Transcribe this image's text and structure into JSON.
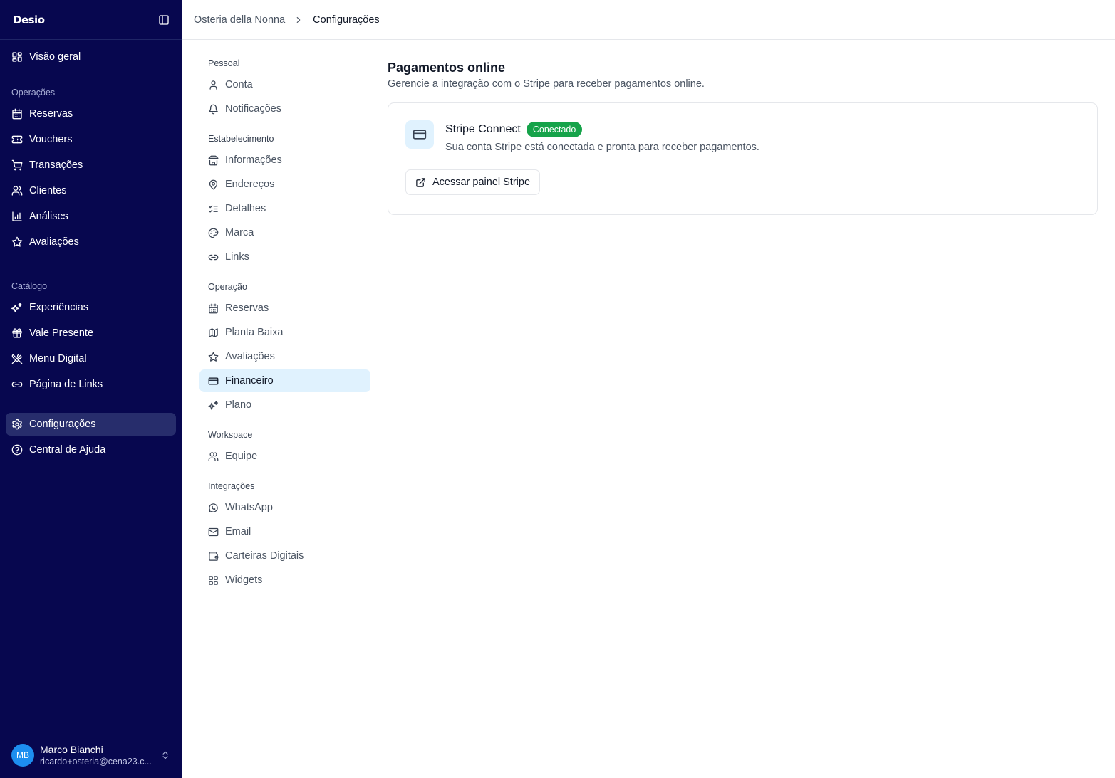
{
  "sidebar": {
    "logo": "Desio",
    "overview": "Visão geral",
    "groups": [
      {
        "label": "Operações",
        "items": [
          "Reservas",
          "Vouchers",
          "Transações",
          "Clientes",
          "Análises",
          "Avaliações"
        ]
      },
      {
        "label": "Catálogo",
        "items": [
          "Experiências",
          "Vale Presente",
          "Menu Digital",
          "Página de Links"
        ]
      }
    ],
    "bottom_items": [
      "Configurações",
      "Central de Ajuda"
    ],
    "user": {
      "initials": "MB",
      "name": "Marco Bianchi",
      "email": "ricardo+osteria@cena23.c..."
    }
  },
  "breadcrumb": {
    "parent": "Osteria della Nonna",
    "current": "Configurações"
  },
  "settings_nav": {
    "groups": [
      {
        "label": "Pessoal",
        "items": [
          "Conta",
          "Notificações"
        ]
      },
      {
        "label": "Estabelecimento",
        "items": [
          "Informações",
          "Endereços",
          "Detalhes",
          "Marca",
          "Links"
        ]
      },
      {
        "label": "Operação",
        "items": [
          "Reservas",
          "Planta Baixa",
          "Avaliações",
          "Financeiro",
          "Plano"
        ]
      },
      {
        "label": "Workspace",
        "items": [
          "Equipe"
        ]
      },
      {
        "label": "Integrações",
        "items": [
          "WhatsApp",
          "Email",
          "Carteiras Digitais",
          "Widgets"
        ]
      }
    ]
  },
  "page": {
    "title": "Pagamentos online",
    "subtitle": "Gerencie a integração com o Stripe para receber pagamentos online.",
    "card": {
      "title": "Stripe Connect",
      "badge": "Conectado",
      "description": "Sua conta Stripe está conectada e pronta para receber pagamentos.",
      "button": "Acessar painel Stripe"
    }
  },
  "colors": {
    "sidebar_bg": "#07074f",
    "active_sidebar_item": "#272d6c",
    "active_settings_item": "#e0f2fe",
    "badge_green": "#16a34a",
    "avatar_blue": "#1d8ef0"
  }
}
